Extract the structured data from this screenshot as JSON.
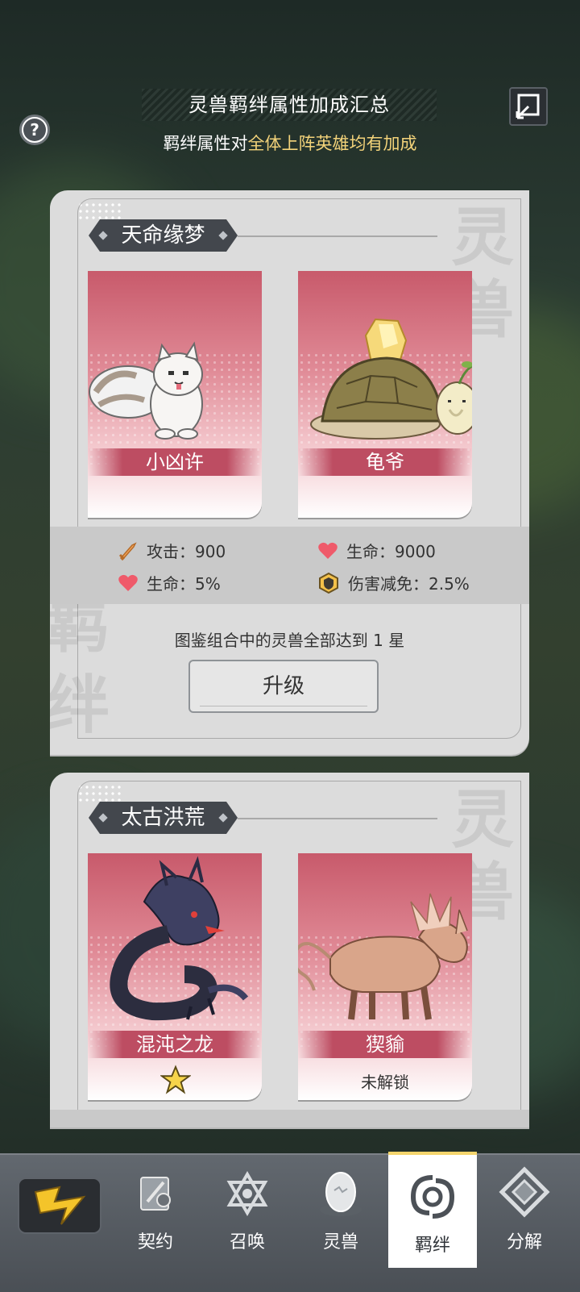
{
  "header": {
    "title": "灵兽羁绊属性加成汇总",
    "subtitle_prefix": "羁绊属性对",
    "subtitle_highlight": "全体上阵英雄均有加成"
  },
  "groups": [
    {
      "label": "天命缘梦",
      "cards": [
        {
          "name": "小凶许",
          "icon": "white-squirrel"
        },
        {
          "name": "龟爷",
          "icon": "crystal-turtle"
        }
      ],
      "stats": [
        {
          "icon": "sword-icon",
          "text": "攻击：900"
        },
        {
          "icon": "heart-icon",
          "text": "生命：9000"
        },
        {
          "icon": "heart-icon",
          "text": "生命：5%"
        },
        {
          "icon": "shield-icon",
          "text": "伤害减免：2.5%"
        }
      ],
      "requirement": "图鉴组合中的灵兽全部达到 1 星",
      "button": "升级"
    },
    {
      "label": "太古洪荒",
      "cards": [
        {
          "name": "混沌之龙",
          "icon": "chaos-dragon",
          "stars": 1
        },
        {
          "name": "猰貐",
          "icon": "beast-yayu",
          "status": "未解锁"
        }
      ]
    }
  ],
  "nav": {
    "items": [
      {
        "label": "契约",
        "icon": "contract-icon"
      },
      {
        "label": "召唤",
        "icon": "summon-icon"
      },
      {
        "label": "灵兽",
        "icon": "egg-icon"
      },
      {
        "label": "羁绊",
        "icon": "bond-icon",
        "active": true
      },
      {
        "label": "分解",
        "icon": "decompose-icon"
      }
    ]
  },
  "colors": {
    "highlight": "#f3d37a",
    "card_top": "#c85a6b",
    "name_band": "#bd4d62",
    "panel": "#dcdcdc",
    "nav_active_bar": "#f4d56c"
  }
}
